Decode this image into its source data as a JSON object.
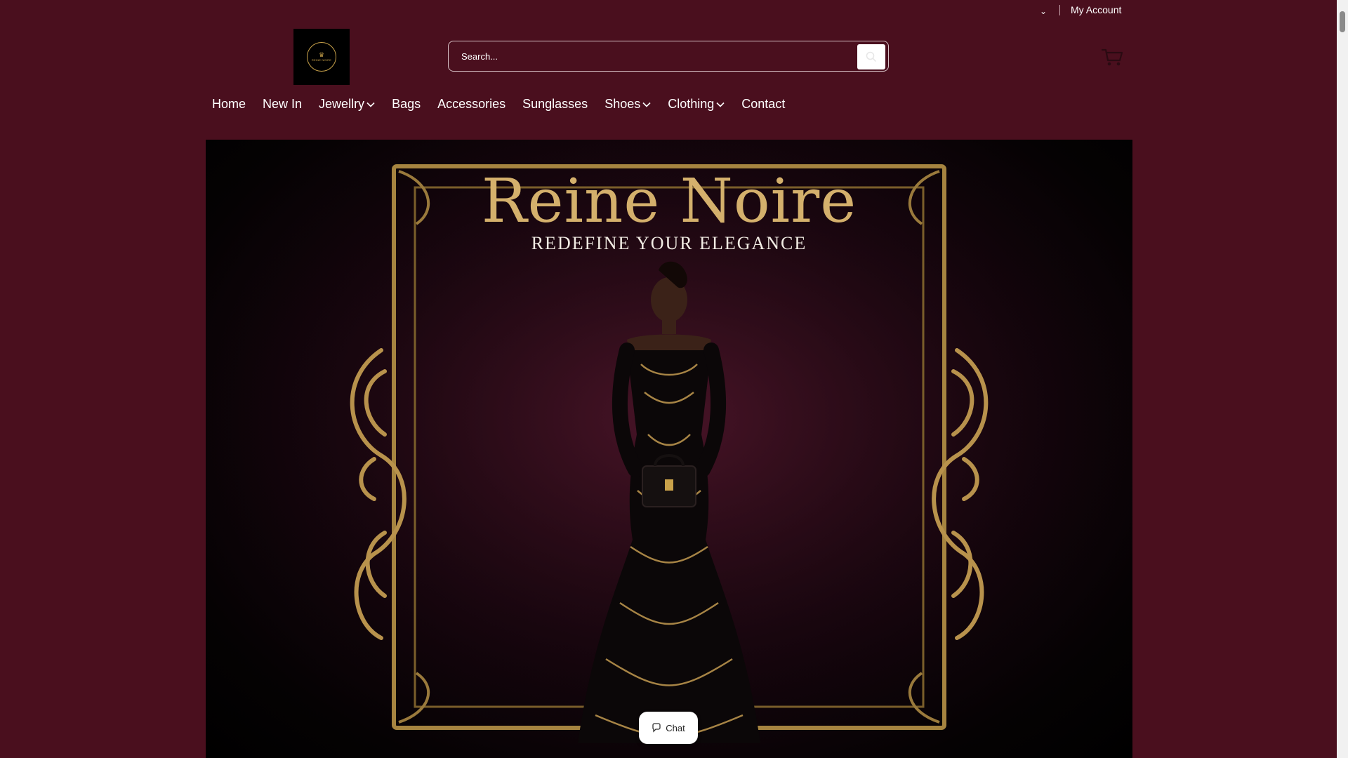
{
  "header": {
    "currency_chevron": "⌄",
    "my_account": "My Account",
    "logo_alt": "REINE NOIRE",
    "search_placeholder": "Search..."
  },
  "nav": {
    "items": [
      {
        "label": "Home",
        "has_dropdown": false
      },
      {
        "label": "New In",
        "has_dropdown": false
      },
      {
        "label": "Jewellry",
        "has_dropdown": true
      },
      {
        "label": "Bags",
        "has_dropdown": false
      },
      {
        "label": "Accessories",
        "has_dropdown": false
      },
      {
        "label": "Sunglasses",
        "has_dropdown": false
      },
      {
        "label": "Shoes",
        "has_dropdown": true
      },
      {
        "label": "Clothing",
        "has_dropdown": true
      },
      {
        "label": "Contact",
        "has_dropdown": false
      }
    ]
  },
  "hero": {
    "title": "Reine Noire",
    "subtitle": "REDEFINE YOUR ELEGANCE"
  },
  "chat": {
    "label": "Chat"
  },
  "colors": {
    "page_background": "#4a0f1e",
    "gold": "#d4b06c",
    "text": "#ffffff"
  }
}
